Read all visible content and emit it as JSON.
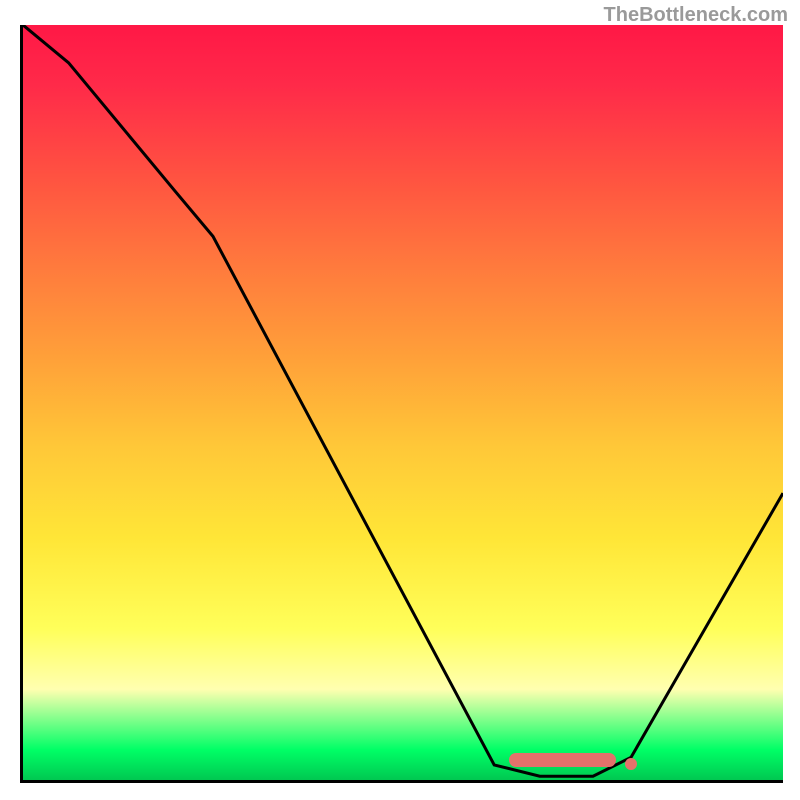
{
  "watermark": "TheBottleneck.com",
  "chart_data": {
    "type": "line",
    "title": "",
    "xlabel": "",
    "ylabel": "",
    "xlim": [
      0,
      100
    ],
    "ylim": [
      0,
      100
    ],
    "grid": false,
    "background_gradient": {
      "direction": "vertical",
      "stops": [
        {
          "pos": 0,
          "color": "#ff1846"
        },
        {
          "pos": 20,
          "color": "#ff5241"
        },
        {
          "pos": 44,
          "color": "#ffa039"
        },
        {
          "pos": 68,
          "color": "#ffe637"
        },
        {
          "pos": 88,
          "color": "#ffffb0"
        },
        {
          "pos": 96,
          "color": "#00ff66"
        },
        {
          "pos": 100,
          "color": "#00c851"
        }
      ]
    },
    "series": [
      {
        "name": "bottleneck-curve",
        "x": [
          0,
          6,
          20,
          25,
          62,
          68,
          75,
          80,
          84,
          100
        ],
        "y": [
          100,
          95,
          78,
          72,
          2,
          0.5,
          0.5,
          3,
          10,
          38
        ]
      }
    ],
    "markers": {
      "name": "optimal-range",
      "y": 1.5,
      "x_band": [
        64,
        78
      ],
      "end_dot_x": 80,
      "color": "#e4716b"
    }
  }
}
